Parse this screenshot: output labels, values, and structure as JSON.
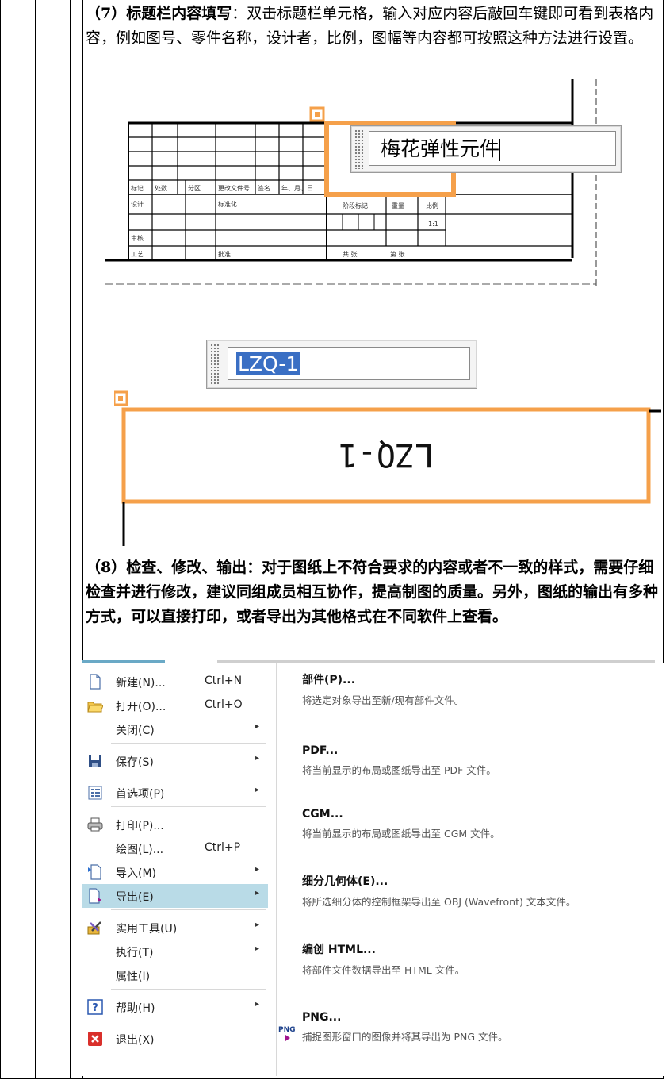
{
  "section7": {
    "heading": "（7）标题栏内容填写",
    "body": "：双击标题栏单元格，输入对应内容后敲回车键即可看到表格内容，例如图号、零件名称，设计者，比例，图幅等内容都可按照这种方法进行设置。",
    "popup_text": "梅花弹性元件",
    "table_labels": [
      "标记",
      "处数",
      "分区",
      "更改文件号",
      "签名",
      "年、月、日",
      "设计",
      "标准化",
      "阶段标记",
      "重量",
      "比例",
      "审核",
      "批准",
      "共 张",
      "第 张",
      "工艺",
      "1:1"
    ]
  },
  "drawing2": {
    "input_text": "LZQ-1",
    "mirrored_text": "LZQ-1"
  },
  "section8": {
    "heading": "（8）检查、修改、输出",
    "body": "：对于图纸上不符合要求的内容或者不一致的样式，需要仔细检查并进行修改，建议同组成员相互协作，提高制图的质量。另外，图纸的输出有多种方式，可以直接打印，或者导出为其他格式在不同软件上查看。"
  },
  "menu": {
    "left": [
      {
        "label": "新建(N)...",
        "shortcut": "Ctrl+N",
        "arrow": "",
        "icon": "new-file-icon"
      },
      {
        "label": "打开(O)...",
        "shortcut": "Ctrl+O",
        "arrow": "",
        "icon": "open-folder-icon"
      },
      {
        "label": "关闭(C)",
        "shortcut": "",
        "arrow": "▸",
        "icon": ""
      },
      {
        "label": "保存(S)",
        "shortcut": "",
        "arrow": "▸",
        "icon": "save-icon"
      },
      {
        "label": "首选项(P)",
        "shortcut": "",
        "arrow": "▸",
        "icon": "preferences-icon"
      },
      {
        "label": "打印(P)...",
        "shortcut": "",
        "arrow": "",
        "icon": "printer-icon"
      },
      {
        "label": "绘图(L)...",
        "shortcut": "Ctrl+P",
        "arrow": "",
        "icon": ""
      },
      {
        "label": "导入(M)",
        "shortcut": "",
        "arrow": "▸",
        "icon": "import-icon"
      },
      {
        "label": "导出(E)",
        "shortcut": "",
        "arrow": "▸",
        "icon": "export-icon"
      },
      {
        "label": "实用工具(U)",
        "shortcut": "",
        "arrow": "▸",
        "icon": "tools-icon"
      },
      {
        "label": "执行(T)",
        "shortcut": "",
        "arrow": "▸",
        "icon": ""
      },
      {
        "label": "属性(I)",
        "shortcut": "",
        "arrow": "",
        "icon": ""
      },
      {
        "label": "帮助(H)",
        "shortcut": "",
        "arrow": "▸",
        "icon": "help-icon"
      },
      {
        "label": "退出(X)",
        "shortcut": "",
        "arrow": "",
        "icon": "exit-icon"
      }
    ],
    "right": [
      {
        "title": "部件(P)...",
        "desc": "将选定对象导出至新/现有部件文件。"
      },
      {
        "title": "PDF...",
        "desc": "将当前显示的布局或图纸导出至 PDF 文件。"
      },
      {
        "title": "CGM...",
        "desc": "将当前显示的布局或图纸导出至 CGM 文件。"
      },
      {
        "title": "细分几何体(E)...",
        "desc": "将所选细分体的控制框架导出至 OBJ (Wavefront) 文本文件。"
      },
      {
        "title": "编创 HTML...",
        "desc": "将部件文件数据导出至 HTML 文件。"
      },
      {
        "title": "PNG...",
        "desc": "捕捉图形窗口的图像并将其导出为 PNG 文件。"
      }
    ],
    "png_icon_text": "PNG"
  },
  "colors": {
    "highlight": "#b9dbe7",
    "orange": "#f5a04a",
    "selection": "#3a6fc4"
  }
}
